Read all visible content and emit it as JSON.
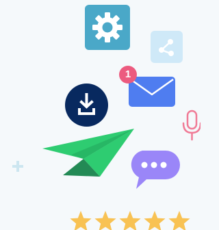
{
  "icons": {
    "settings": "gear-icon",
    "share": "share-icon",
    "mail": "envelope-icon",
    "download": "download-icon",
    "microphone": "microphone-icon",
    "send": "paper-plane-icon",
    "chat": "chat-bubble-icon",
    "plus": "plus-icon",
    "star": "star-icon"
  },
  "notification": {
    "count": "1"
  },
  "rating": {
    "stars": 5,
    "max": 5
  },
  "colors": {
    "background": "#f5f9fb",
    "gear_tile": "#4aa8c8",
    "share_tile": "#cfe9f8",
    "envelope": "#4f7df0",
    "badge": "#ec5b7f",
    "download_circle": "#08295f",
    "microphone": "#f07b96",
    "plane_light": "#2ecc71",
    "plane_dark": "#238a55",
    "chat_bubble": "#9a86f8",
    "star": "#f8c253",
    "plus": "#cce6f0"
  }
}
